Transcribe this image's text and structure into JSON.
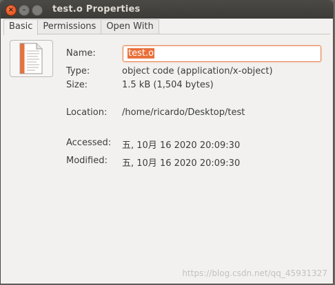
{
  "window": {
    "title": "test.o Properties",
    "close_glyph": "×",
    "min_glyph": "–",
    "max_glyph": ""
  },
  "tabs": [
    {
      "label": "Basic",
      "active": true
    },
    {
      "label": "Permissions",
      "active": false
    },
    {
      "label": "Open With",
      "active": false
    }
  ],
  "basic": {
    "icon": "text-file-icon",
    "name_label": "Name:",
    "name_value": "test.o",
    "type_label": "Type:",
    "type_value": "object code (application/x-object)",
    "size_label": "Size:",
    "size_value": "1.5 kB (1,504 bytes)",
    "location_label": "Location:",
    "location_value": "/home/ricardo/Desktop/test",
    "accessed_label": "Accessed:",
    "accessed_value": "五, 10月 16 2020 20:09:30",
    "modified_label": "Modified:",
    "modified_value": "五, 10月 16 2020 20:09:30"
  },
  "watermark": "https://blog.csdn.net/qq_45931327",
  "colors": {
    "accent": "#e9703b",
    "titlebar": "#3c3b37",
    "window_bg": "#f2f1f0"
  }
}
